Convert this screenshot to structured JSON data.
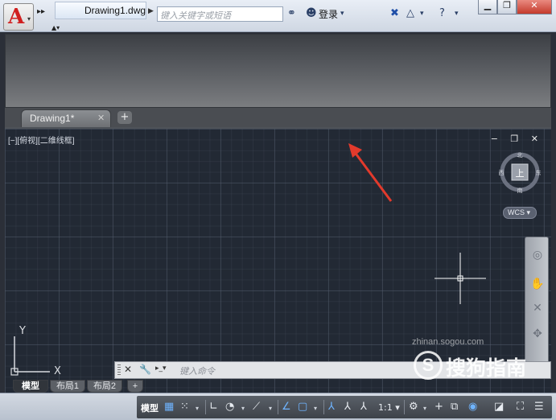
{
  "titlebar": {
    "doc_title": "Drawing1.dwg",
    "search_placeholder": "键入关键字或短语",
    "login": "登录",
    "app_letter": "A"
  },
  "tabs": [
    {
      "label": "Drawing1*",
      "close": "✕"
    }
  ],
  "tab_add": "+",
  "viewport": {
    "label": "[−][俯视][二维线框]",
    "controls": "− ❐ ✕",
    "viewcube": {
      "north": "北",
      "south": "南",
      "east": "东",
      "west": "西",
      "top": "上"
    },
    "wcs": "WCS ▾",
    "ucs": {
      "x": "X",
      "y": "Y"
    }
  },
  "command_line": {
    "placeholder": "键入命令"
  },
  "layout_tabs": [
    {
      "label": "模型",
      "active": true
    },
    {
      "label": "布局1",
      "active": false
    },
    {
      "label": "布局2",
      "active": false
    }
  ],
  "layout_add": "+",
  "statusbar": {
    "model": "模型",
    "scale": "1:1 ▾"
  },
  "watermark": {
    "url": "zhinan.sogou.com",
    "brand": "搜狗指南",
    "logo_letter": "S"
  },
  "colors": {
    "arrow": "#e23a2c",
    "autocad_red": "#d01f1f",
    "viewport_bg": "#222934"
  }
}
